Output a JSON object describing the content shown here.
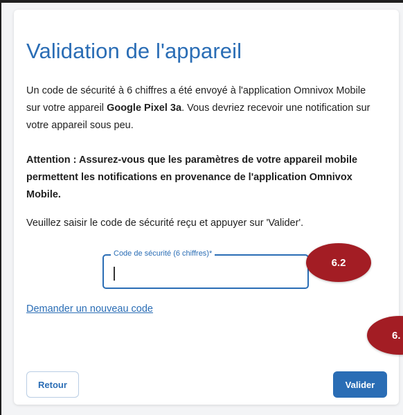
{
  "page": {
    "title": "Validation de l'appareil",
    "intro": {
      "before_device": "Un code de sécurité à 6 chiffres a été envoyé à l'application Omnivox Mobile sur votre appareil ",
      "device": "Google Pixel 3a",
      "after_device": ". Vous devriez recevoir une notification sur votre appareil sous peu."
    },
    "warning": "Attention : Assurez-vous que les paramètres de votre appareil mobile permettent les notifications en provenance de l'application Omnivox Mobile.",
    "instruction": "Veuillez saisir le code de sécurité reçu et appuyer sur 'Valider'."
  },
  "code_field": {
    "label": "Code de sécurité (6 chiffres)*",
    "value": "",
    "placeholder": ""
  },
  "links": {
    "new_code": "Demander un nouveau code"
  },
  "buttons": {
    "back": "Retour",
    "submit": "Valider"
  },
  "annotations": {
    "badge_field": "6.2",
    "badge_submit": "6."
  },
  "colors": {
    "accent": "#2a6db5",
    "badge": "#a31d24",
    "text": "#1f1f1f"
  }
}
